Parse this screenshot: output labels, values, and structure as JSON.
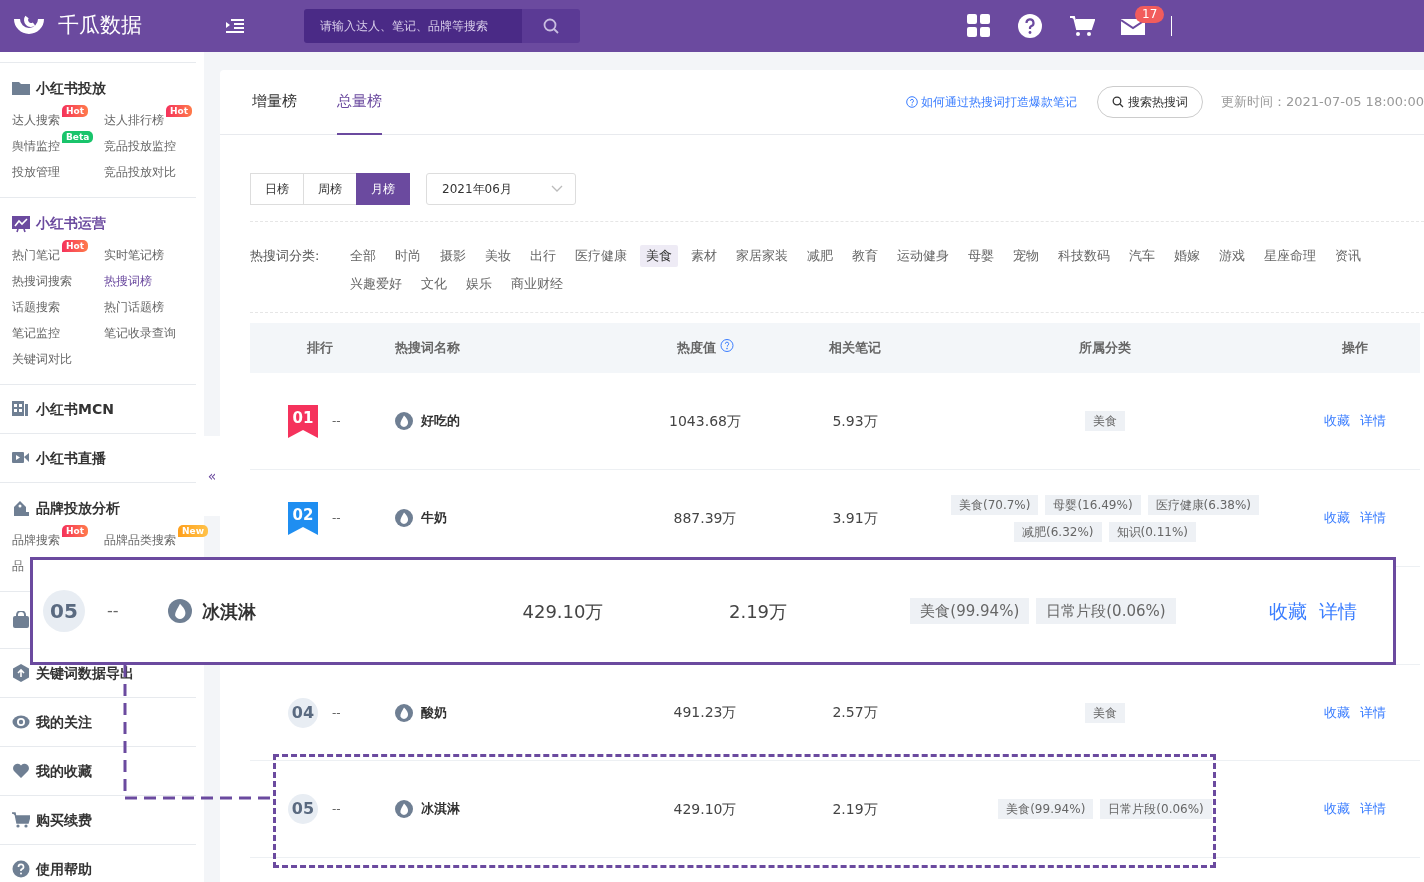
{
  "header": {
    "logo_text": "千瓜数据",
    "search": {
      "placeholder": "请输入达人、笔记、品牌等搜索"
    },
    "mail_badge": "17"
  },
  "sidebar": {
    "collapse_glyph": "«",
    "sections": [
      {
        "title": "小红书投放",
        "selected": false,
        "items": [
          {
            "label": "达人搜索",
            "badge": {
              "text": "Hot",
              "kind": "hot"
            },
            "selected": false
          },
          {
            "label": "达人排行榜",
            "badge": {
              "text": "Hot",
              "kind": "hot"
            },
            "selected": false
          },
          {
            "label": "舆情监控",
            "badge": {
              "text": "Beta",
              "kind": "beta"
            },
            "selected": false
          },
          {
            "label": "竞品投放监控",
            "selected": false
          },
          {
            "label": "投放管理",
            "selected": false
          },
          {
            "label": "竞品投放对比",
            "selected": false
          }
        ]
      },
      {
        "title": "小红书运营",
        "selected": true,
        "items": [
          {
            "label": "热门笔记",
            "badge": {
              "text": "Hot",
              "kind": "hot"
            },
            "selected": false
          },
          {
            "label": "实时笔记榜",
            "selected": false
          },
          {
            "label": "热搜词搜索",
            "selected": false
          },
          {
            "label": "热搜词榜",
            "selected": true
          },
          {
            "label": "话题搜索",
            "selected": false
          },
          {
            "label": "热门话题榜",
            "selected": false
          },
          {
            "label": "笔记监控",
            "selected": false
          },
          {
            "label": "笔记收录查询",
            "selected": false
          },
          {
            "label": "关键词对比",
            "selected": false
          }
        ]
      },
      {
        "title": "小红书MCN",
        "selected": false
      },
      {
        "title": "小红书直播",
        "selected": false
      },
      {
        "title": "品牌投放分析",
        "selected": false,
        "items": [
          {
            "label": "品牌搜索",
            "badge": {
              "text": "Hot",
              "kind": "hot"
            },
            "selected": false
          },
          {
            "label": "品牌品类搜索",
            "badge": {
              "text": "New",
              "kind": "new"
            },
            "selected": false
          },
          {
            "label": "品",
            "selected": false
          }
        ]
      },
      {
        "kind": "icon"
      },
      {
        "title": "关键词数据导出",
        "selected": false
      },
      {
        "title": "我的关注",
        "selected": false
      },
      {
        "title": "我的收藏",
        "selected": false
      },
      {
        "title": "购买续费",
        "selected": false
      },
      {
        "title": "使用帮助",
        "selected": false
      }
    ]
  },
  "main": {
    "tabs": [
      {
        "label": "增量榜",
        "selected": false
      },
      {
        "label": "总量榜",
        "selected": true
      }
    ],
    "help_link": "如何通过热搜词打造爆款笔记",
    "search_button": "搜索热搜词",
    "update_time": "更新时间：2021-07-05 18:00:00",
    "periods": [
      {
        "label": "日榜",
        "selected": false
      },
      {
        "label": "周榜",
        "selected": false
      },
      {
        "label": "月榜",
        "selected": true
      }
    ],
    "month_select": "2021年06月",
    "category_label": "热搜词分类:",
    "categories": [
      {
        "label": "全部",
        "selected": false
      },
      {
        "label": "时尚",
        "selected": false
      },
      {
        "label": "摄影",
        "selected": false
      },
      {
        "label": "美妆",
        "selected": false
      },
      {
        "label": "出行",
        "selected": false
      },
      {
        "label": "医疗健康",
        "selected": false
      },
      {
        "label": "美食",
        "selected": true
      },
      {
        "label": "素材",
        "selected": false
      },
      {
        "label": "家居家装",
        "selected": false
      },
      {
        "label": "减肥",
        "selected": false
      },
      {
        "label": "教育",
        "selected": false
      },
      {
        "label": "运动健身",
        "selected": false
      },
      {
        "label": "母婴",
        "selected": false
      },
      {
        "label": "宠物",
        "selected": false
      },
      {
        "label": "科技数码",
        "selected": false
      },
      {
        "label": "汽车",
        "selected": false
      },
      {
        "label": "婚嫁",
        "selected": false
      },
      {
        "label": "游戏",
        "selected": false
      },
      {
        "label": "星座命理",
        "selected": false
      },
      {
        "label": "资讯",
        "selected": false
      },
      {
        "label": "兴趣爱好",
        "selected": false
      },
      {
        "label": "文化",
        "selected": false
      },
      {
        "label": "娱乐",
        "selected": false
      },
      {
        "label": "商业财经",
        "selected": false
      }
    ],
    "table": {
      "columns": [
        {
          "label": "排行"
        },
        {
          "label": "热搜词名称"
        },
        {
          "label": "热度值",
          "help": true
        },
        {
          "label": "相关笔记"
        },
        {
          "label": "所属分类"
        },
        {
          "label": "操作"
        }
      ],
      "rows": [
        {
          "rank": "01",
          "kind": "ribbon",
          "color": "#f5325c",
          "change": "--",
          "keyword": "好吃的",
          "heat": "1043.68万",
          "notes": "5.93万",
          "tags": [
            "美食"
          ],
          "actions": [
            "收藏",
            "详情"
          ]
        },
        {
          "rank": "02",
          "kind": "ribbon",
          "color": "#1f8ef1",
          "change": "--",
          "keyword": "牛奶",
          "heat": "887.39万",
          "notes": "3.91万",
          "tags": [
            "美食(70.7%)",
            "母婴(16.49%)",
            "医疗健康(6.38%)",
            "减肥(6.32%)",
            "知识(0.11%)"
          ],
          "actions": [
            "收藏",
            "详情"
          ]
        },
        {
          "rank": "04",
          "kind": "circle",
          "change": "--",
          "keyword": "酸奶",
          "heat": "491.23万",
          "notes": "2.57万",
          "tags": [
            "美食"
          ],
          "actions": [
            "收藏",
            "详情"
          ],
          "gap_before": true
        },
        {
          "rank": "05",
          "kind": "circle",
          "change": "--",
          "keyword": "冰淇淋",
          "heat": "429.10万",
          "notes": "2.19万",
          "tags": [
            "美食(99.94%)",
            "日常片段(0.06%)"
          ],
          "actions": [
            "收藏",
            "详情"
          ],
          "highlighted": true
        }
      ]
    }
  },
  "callout": {
    "rank": "05",
    "kind": "circle",
    "change": "--",
    "keyword": "冰淇淋",
    "heat": "429.10万",
    "notes": "2.19万",
    "tags": [
      "美食(99.94%)",
      "日常片段(0.06%)"
    ],
    "actions": [
      "收藏",
      "详情"
    ]
  }
}
